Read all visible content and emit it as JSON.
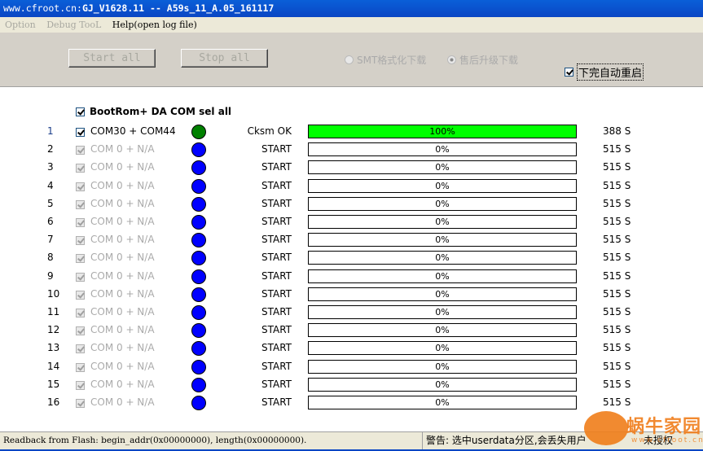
{
  "window": {
    "title_prefix": "www.cfroot.cn:",
    "title_main": "GJ_V1628.11 -- A59s_11_A.05_161117"
  },
  "menu": [
    {
      "label": "Option",
      "enabled": false
    },
    {
      "label": "Debug TooL",
      "enabled": false
    },
    {
      "label": "Help(open log file)",
      "enabled": true
    }
  ],
  "toolbar": {
    "start_all": "Start all",
    "stop_all": "Stop all",
    "radio_smt": "SMT格式化下载",
    "radio_aftersale": "售后升级下载",
    "radio_selected": "aftersale",
    "auto_reboot_label": "下完自动重启",
    "auto_reboot_checked": true
  },
  "main": {
    "select_all_label": "BootRom+ DA COM sel all",
    "select_all_checked": true,
    "progress_color": "#00ff00",
    "rows": [
      {
        "num": "1",
        "com": "COM30 + COM44",
        "status": "Cksm OK",
        "progress": 100,
        "pct": "100%",
        "time": "388 S",
        "dot": "#008000",
        "active": true
      },
      {
        "num": "2",
        "com": "COM 0 + N/A",
        "status": "START",
        "progress": 0,
        "pct": "0%",
        "time": "515 S",
        "dot": "#0000ff",
        "active": false
      },
      {
        "num": "3",
        "com": "COM 0 + N/A",
        "status": "START",
        "progress": 0,
        "pct": "0%",
        "time": "515 S",
        "dot": "#0000ff",
        "active": false
      },
      {
        "num": "4",
        "com": "COM 0 + N/A",
        "status": "START",
        "progress": 0,
        "pct": "0%",
        "time": "515 S",
        "dot": "#0000ff",
        "active": false
      },
      {
        "num": "5",
        "com": "COM 0 + N/A",
        "status": "START",
        "progress": 0,
        "pct": "0%",
        "time": "515 S",
        "dot": "#0000ff",
        "active": false
      },
      {
        "num": "6",
        "com": "COM 0 + N/A",
        "status": "START",
        "progress": 0,
        "pct": "0%",
        "time": "515 S",
        "dot": "#0000ff",
        "active": false
      },
      {
        "num": "7",
        "com": "COM 0 + N/A",
        "status": "START",
        "progress": 0,
        "pct": "0%",
        "time": "515 S",
        "dot": "#0000ff",
        "active": false
      },
      {
        "num": "8",
        "com": "COM 0 + N/A",
        "status": "START",
        "progress": 0,
        "pct": "0%",
        "time": "515 S",
        "dot": "#0000ff",
        "active": false
      },
      {
        "num": "9",
        "com": "COM 0 + N/A",
        "status": "START",
        "progress": 0,
        "pct": "0%",
        "time": "515 S",
        "dot": "#0000ff",
        "active": false
      },
      {
        "num": "10",
        "com": "COM 0 + N/A",
        "status": "START",
        "progress": 0,
        "pct": "0%",
        "time": "515 S",
        "dot": "#0000ff",
        "active": false
      },
      {
        "num": "11",
        "com": "COM 0 + N/A",
        "status": "START",
        "progress": 0,
        "pct": "0%",
        "time": "515 S",
        "dot": "#0000ff",
        "active": false
      },
      {
        "num": "12",
        "com": "COM 0 + N/A",
        "status": "START",
        "progress": 0,
        "pct": "0%",
        "time": "515 S",
        "dot": "#0000ff",
        "active": false
      },
      {
        "num": "13",
        "com": "COM 0 + N/A",
        "status": "START",
        "progress": 0,
        "pct": "0%",
        "time": "515 S",
        "dot": "#0000ff",
        "active": false
      },
      {
        "num": "14",
        "com": "COM 0 + N/A",
        "status": "START",
        "progress": 0,
        "pct": "0%",
        "time": "515 S",
        "dot": "#0000ff",
        "active": false
      },
      {
        "num": "15",
        "com": "COM 0 + N/A",
        "status": "START",
        "progress": 0,
        "pct": "0%",
        "time": "515 S",
        "dot": "#0000ff",
        "active": false
      },
      {
        "num": "16",
        "com": "COM 0 + N/A",
        "status": "START",
        "progress": 0,
        "pct": "0%",
        "time": "515 S",
        "dot": "#0000ff",
        "active": false
      }
    ]
  },
  "statusbar": {
    "readback": "Readback from Flash:  begin_addr(0x00000000), length(0x00000000).",
    "warning": "警告: 选中userdata分区,会丢失用户",
    "license": "未授权"
  },
  "watermark": {
    "text": "蜗牛家园",
    "url": "www.cfroot.cn",
    "glyph": "家"
  }
}
